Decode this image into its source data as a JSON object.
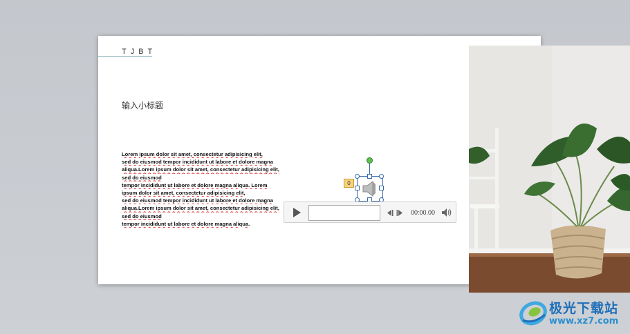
{
  "slide": {
    "title": "TJBT",
    "subtitle": "输入小标题",
    "body_lines": [
      "Lorem ipsum dolor sit amet, consectetur adipisicing elit,",
      "sed do eiusmod tempor incididunt ut labore et dolore magna",
      "aliqua.Lorem ipsum dolor sit amet, consectetur adipisicing elit,",
      "sed do eiusmod",
      "tempor incididunt ut labore et dolore magna aliqua. Lorem",
      "ipsum dolor sit amet, consectetur adipisicing elit,",
      "sed do eiusmod tempor incididunt ut labore et dolore magna",
      "aliqua.Lorem ipsum dolor sit amet, consectetur adipisicing elit,",
      "sed do eiusmod",
      "tempor incididunt ut labore et dolore magna aliqua."
    ]
  },
  "audio": {
    "animation_tag": "0",
    "time": "00:00.00",
    "icons": [
      "speaker-icon",
      "play-icon",
      "skip-back-icon",
      "skip-forward-icon",
      "volume-icon"
    ]
  },
  "watermark": {
    "name": "极光下载站",
    "url": "www.xz7.com"
  },
  "colors": {
    "background": "#c9cdd2",
    "title_line": "#8fb7c0",
    "selection": "#3a6aa8",
    "rotate_handle": "#5ec24e",
    "logo_blue": "#1f6fb8"
  }
}
